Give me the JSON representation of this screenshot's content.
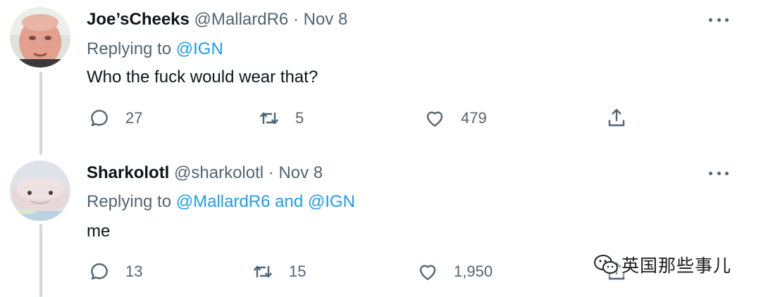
{
  "tweets": [
    {
      "name": "Joe’sCheeks",
      "handle": "@MallardR6",
      "separator": "·",
      "date": "Nov 8",
      "replying_prefix": "Replying to",
      "replying_mentions": [
        "@IGN"
      ],
      "replying_joiner": "",
      "text": "Who the fuck would wear that?",
      "replies": "27",
      "retweets": "5",
      "likes": "479",
      "avatar_icon": "avatar-photo",
      "avatar_colors": {
        "bg": "#e8ece9",
        "skin": "#e6a898",
        "hair": "#f4f0ec"
      }
    },
    {
      "name": "Sharkolotl",
      "handle": "@sharkolotl",
      "separator": "·",
      "date": "Nov 8",
      "replying_prefix": "Replying to",
      "replying_mentions": [
        "@MallardR6",
        "@IGN"
      ],
      "replying_joiner": "and",
      "text": "me",
      "replies": "13",
      "retweets": "15",
      "likes": "1,950",
      "avatar_icon": "avatar-plush",
      "avatar_colors": {
        "bg": "#dfe5ea",
        "plush": "#e7d6d6",
        "blue": "#b7d1e6"
      }
    }
  ],
  "icons": {
    "reply": "speech-bubble-icon",
    "retweet": "retweet-arrows-icon",
    "like": "heart-icon",
    "share": "share-upload-icon",
    "more": "more-dots-icon"
  },
  "colors": {
    "text_primary": "#0f1419",
    "text_secondary": "#536471",
    "mention": "#1d9bf0",
    "thread_line": "#cfd9de"
  },
  "watermark": {
    "text": "英国那些事儿"
  }
}
